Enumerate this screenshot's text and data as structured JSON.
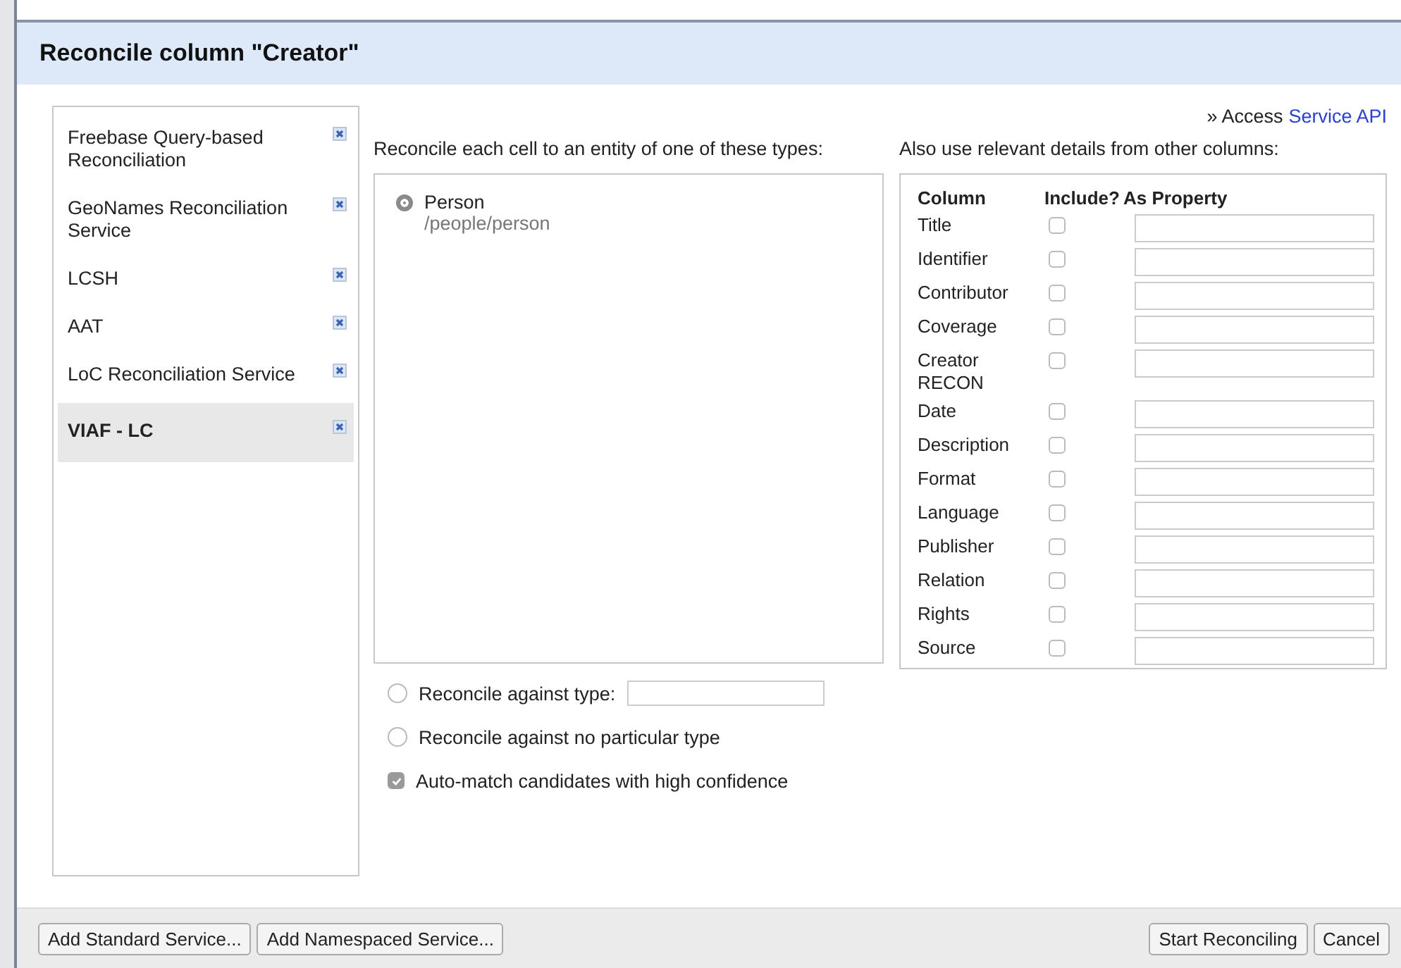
{
  "dialog": {
    "title": "Reconcile column \"Creator\""
  },
  "services": [
    {
      "name": "Freebase Query-based Reconciliation",
      "selected": false
    },
    {
      "name": "GeoNames Reconciliation Service",
      "selected": false
    },
    {
      "name": "LCSH",
      "selected": false
    },
    {
      "name": "AAT",
      "selected": false
    },
    {
      "name": "LoC Reconciliation Service",
      "selected": false
    },
    {
      "name": "VIAF - LC",
      "selected": true
    }
  ],
  "service_api": {
    "prefix": "» Access",
    "link": "Service API"
  },
  "types_label": "Reconcile each cell to an entity of one of these types:",
  "types": [
    {
      "name": "Person",
      "path": "/people/person",
      "selected": true
    }
  ],
  "other_options": [
    {
      "kind": "radio_field",
      "label": "Reconcile against type:",
      "selected": false
    },
    {
      "kind": "radio",
      "label": "Reconcile against no particular type",
      "selected": false
    },
    {
      "kind": "checkbox",
      "label": "Auto-match candidates with high confidence",
      "checked": true
    }
  ],
  "details_label": "Also use relevant details from other columns:",
  "details_table": {
    "columns": [
      "Column",
      "Include?",
      "As Property"
    ],
    "rows": [
      {
        "column": "Title",
        "include": false
      },
      {
        "column": "Identifier",
        "include": false
      },
      {
        "column": "Contributor",
        "include": false
      },
      {
        "column": "Coverage",
        "include": false
      },
      {
        "column": "Creator RECON",
        "include": false
      },
      {
        "column": "Date",
        "include": false
      },
      {
        "column": "Description",
        "include": false
      },
      {
        "column": "Format",
        "include": false
      },
      {
        "column": "Language",
        "include": false
      },
      {
        "column": "Publisher",
        "include": false
      },
      {
        "column": "Relation",
        "include": false
      },
      {
        "column": "Rights",
        "include": false
      },
      {
        "column": "Source",
        "include": false
      }
    ]
  },
  "footer": {
    "left_buttons": [
      "Add Standard Service...",
      "Add Namespaced Service..."
    ],
    "right_buttons": [
      "Start Reconciling",
      "Cancel"
    ]
  }
}
